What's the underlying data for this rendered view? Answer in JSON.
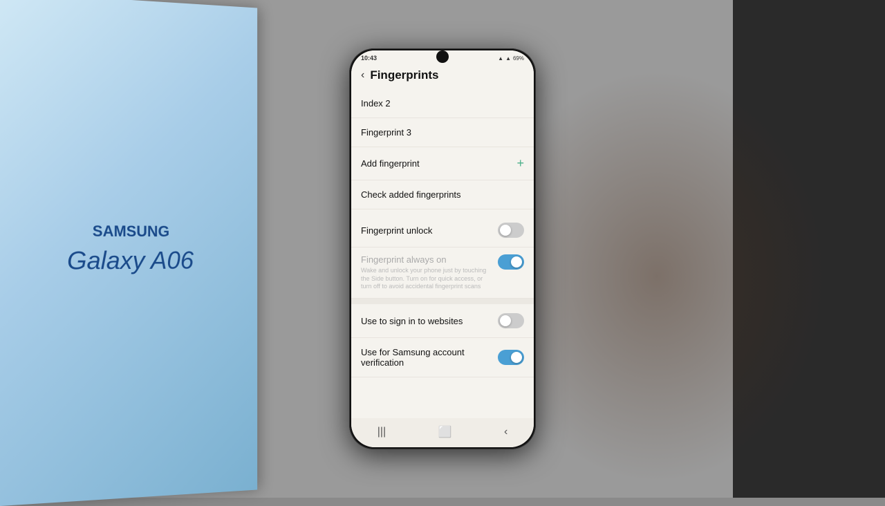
{
  "background": {
    "color": "#8a8888"
  },
  "samsung_box": {
    "brand": "SAMSUNG",
    "model": "Galaxy A06"
  },
  "phone": {
    "status_bar": {
      "time": "10:43",
      "battery": "69%",
      "signal_icon": "📶"
    },
    "header": {
      "back_label": "‹",
      "title": "Fingerprints"
    },
    "list_items": [
      {
        "id": "index2",
        "label": "Index 2",
        "has_toggle": false,
        "has_add": false
      },
      {
        "id": "fingerprint3",
        "label": "Fingerprint 3",
        "has_toggle": false,
        "has_add": false
      },
      {
        "id": "add-fingerprint",
        "label": "Add fingerprint",
        "has_toggle": false,
        "has_add": true
      },
      {
        "id": "check-fingerprints",
        "label": "Check added fingerprints",
        "has_toggle": false,
        "has_add": false
      }
    ],
    "toggle_items": [
      {
        "id": "fingerprint-unlock",
        "label": "Fingerprint unlock",
        "state": "off"
      }
    ],
    "always_on_section": {
      "title": "Fingerprint always on",
      "description": "Wake and unlock your phone just by touching the Side button. Turn on for quick access, or turn off to avoid accidental fingerprint scans",
      "toggle_state": "on"
    },
    "sign_in_item": {
      "label": "Use to sign in to websites",
      "toggle_state": "off"
    },
    "samsung_account_item": {
      "label": "Use for Samsung account verification",
      "toggle_state": "on"
    },
    "nav_bar": {
      "recent_icon": "|||",
      "home_icon": "⬜",
      "back_icon": "‹"
    }
  }
}
